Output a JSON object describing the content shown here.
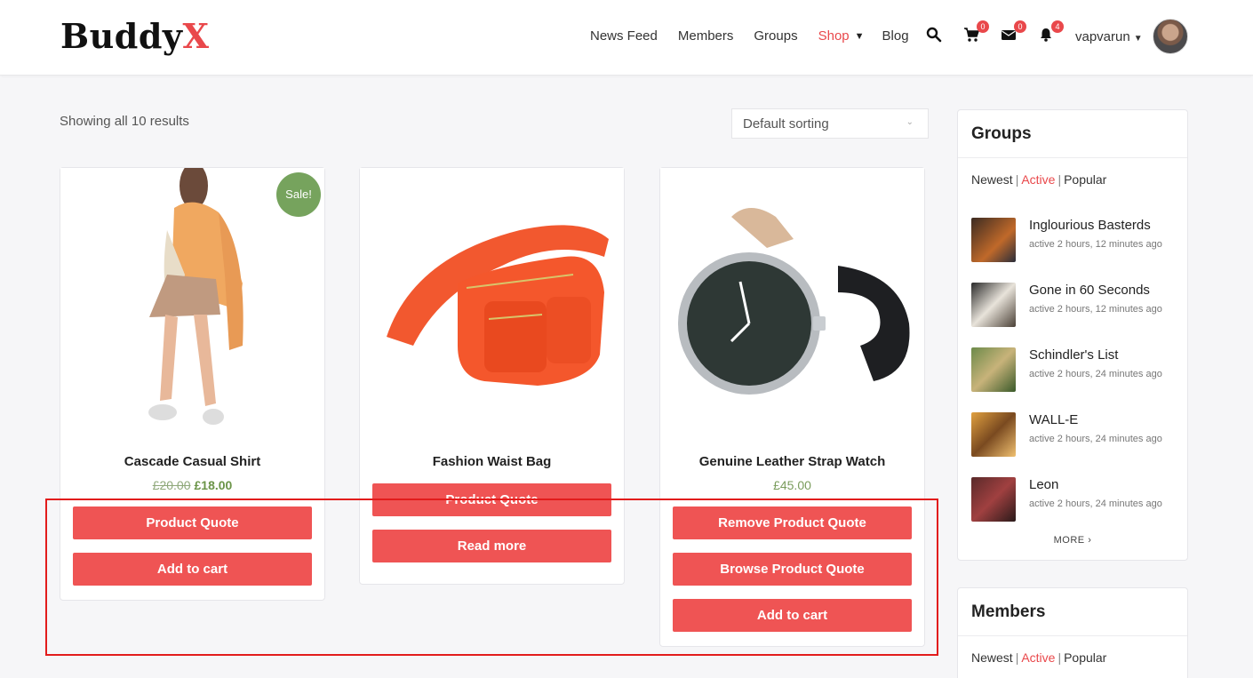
{
  "brand": {
    "logo_main": "Buddy",
    "logo_accent": "X",
    "accent_color": "#e9484b",
    "button_color": "#ef5454",
    "sale_color": "#76a35d"
  },
  "nav": {
    "items": [
      "News Feed",
      "Members",
      "Groups",
      "Shop",
      "Blog"
    ],
    "active": "Shop",
    "cart_count": "0",
    "messages_count": "0",
    "notifications_count": "4",
    "username": "vapvarun"
  },
  "shop": {
    "results_text": "Showing all 10 results",
    "sorting": "Default sorting",
    "products": [
      {
        "name": "Cascade Casual Shirt",
        "old_price": "£20.00",
        "price": "£18.00",
        "sale_badge": "Sale!",
        "buttons": [
          "Product Quote",
          "Add to cart"
        ]
      },
      {
        "name": "Fashion Waist Bag",
        "buttons": [
          "Product Quote",
          "Read more"
        ]
      },
      {
        "name": "Genuine Leather Strap Watch",
        "price": "£45.00",
        "buttons": [
          "Remove Product Quote",
          "Browse Product Quote",
          "Add to cart"
        ]
      }
    ]
  },
  "sidebar": {
    "groups": {
      "title": "Groups",
      "filters": [
        "Newest",
        "Active",
        "Popular"
      ],
      "active_filter": "Active",
      "items": [
        {
          "name": "Inglourious Basterds",
          "meta": "active 2 hours, 12 minutes ago"
        },
        {
          "name": "Gone in 60 Seconds",
          "meta": "active 2 hours, 12 minutes ago"
        },
        {
          "name": "Schindler's List",
          "meta": "active 2 hours, 24 minutes ago"
        },
        {
          "name": "WALL-E",
          "meta": "active 2 hours, 24 minutes ago"
        },
        {
          "name": "Leon",
          "meta": "active 2 hours, 24 minutes ago"
        }
      ],
      "more": "MORE"
    },
    "members": {
      "title": "Members",
      "filters": [
        "Newest",
        "Active",
        "Popular"
      ],
      "active_filter": "Active"
    }
  }
}
